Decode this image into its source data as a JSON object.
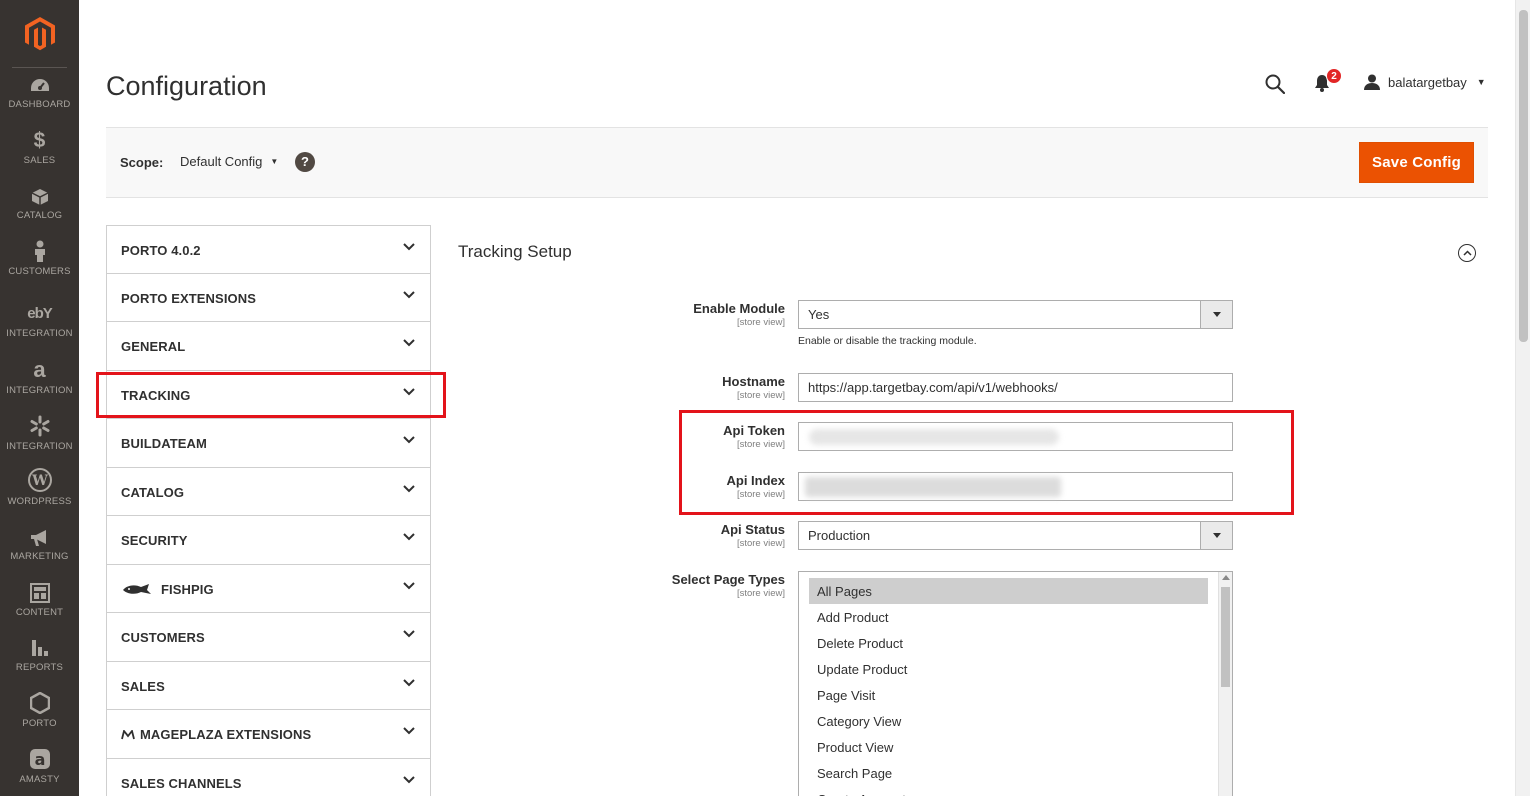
{
  "nav": {
    "items": [
      {
        "label": "DASHBOARD",
        "icon": "dashboard-icon"
      },
      {
        "label": "SALES",
        "icon": "dollar-icon"
      },
      {
        "label": "CATALOG",
        "icon": "box-icon"
      },
      {
        "label": "CUSTOMERS",
        "icon": "person-icon"
      },
      {
        "label": "INTEGRATION",
        "icon": "ebay-icon"
      },
      {
        "label": "INTEGRATION",
        "icon": "amazon-icon"
      },
      {
        "label": "INTEGRATION",
        "icon": "walmart-icon"
      },
      {
        "label": "WORDPRESS",
        "icon": "wordpress-icon"
      },
      {
        "label": "MARKETING",
        "icon": "megaphone-icon"
      },
      {
        "label": "CONTENT",
        "icon": "content-icon"
      },
      {
        "label": "REPORTS",
        "icon": "bar-chart-icon"
      },
      {
        "label": "PORTO",
        "icon": "hexagon-icon"
      },
      {
        "label": "AMASTY",
        "icon": "amasty-icon"
      }
    ]
  },
  "header": {
    "title": "Configuration",
    "notifications_count": "2",
    "username": "balatargetbay"
  },
  "scope": {
    "label": "Scope:",
    "value": "Default Config",
    "help": "?",
    "save_label": "Save Config"
  },
  "tabs": [
    {
      "label": "PORTO 4.0.2"
    },
    {
      "label": "PORTO EXTENSIONS"
    },
    {
      "label": "GENERAL"
    },
    {
      "label": "TRACKING"
    },
    {
      "label": "BUILDATEAM"
    },
    {
      "label": "CATALOG"
    },
    {
      "label": "SECURITY"
    },
    {
      "label": "FISHPIG"
    },
    {
      "label": "CUSTOMERS"
    },
    {
      "label": "SALES"
    },
    {
      "label": "MAGEPLAZA EXTENSIONS"
    },
    {
      "label": "SALES CHANNELS"
    }
  ],
  "section": {
    "title": "Tracking Setup",
    "fields": {
      "enable_module": {
        "label": "Enable Module",
        "scope": "[store view]",
        "value": "Yes",
        "note": "Enable or disable the tracking module."
      },
      "hostname": {
        "label": "Hostname",
        "scope": "[store view]",
        "value": "https://app.targetbay.com/api/v1/webhooks/"
      },
      "api_token": {
        "label": "Api Token",
        "scope": "[store view]"
      },
      "api_index": {
        "label": "Api Index",
        "scope": "[store view]"
      },
      "api_status": {
        "label": "Api Status",
        "scope": "[store view]",
        "value": "Production"
      },
      "page_types": {
        "label": "Select Page Types",
        "scope": "[store view]",
        "options": [
          "All Pages",
          "Add Product",
          "Delete Product",
          "Update Product",
          "Page Visit",
          "Category View",
          "Product View",
          "Search Page",
          "Create Account"
        ],
        "selected": "All Pages"
      }
    }
  },
  "colors": {
    "accent": "#eb5202",
    "nav_bg": "#373330",
    "highlight": "#e3131a"
  }
}
